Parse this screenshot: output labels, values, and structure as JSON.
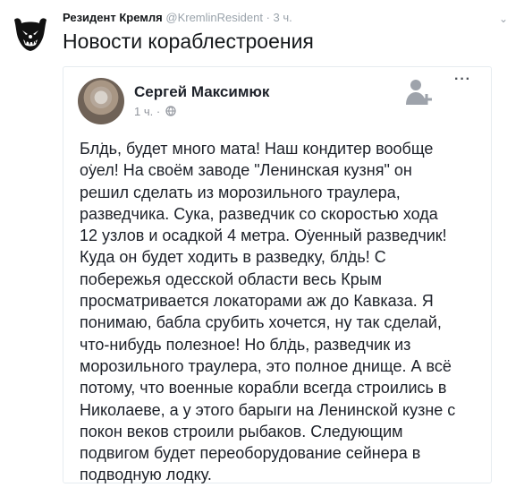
{
  "tweet": {
    "author_name": "Резидент Кремля",
    "handle": "@KremlinResident",
    "separator": "·",
    "time": "3 ч.",
    "text": "Новости кораблестроения"
  },
  "embedded_post": {
    "name": "Сергей Максимюк",
    "meta": "1 ч. ·",
    "lines": [
      "Бл͘дь, будет много мата! Наш кондитер вообще",
      "о͘уел! На своём заводе \"Ленинская кузня\" он",
      "решил сделать из морозильного траулера,",
      "разведчика. Сука, разведчик со скоростью хода",
      "12 узлов и осадкой 4 метра. О͘уенный разведчик!",
      "Куда он будет ходить в разведку, бл͘дь! С",
      "побережья одесской области весь Крым",
      "просматривается локаторами аж до Кавказа. Я",
      "понимаю, бабла срубить хочется, ну так сделай,",
      "что-нибудь полезное! Но бл͘дь, разведчик из",
      "морозильного траулера, это полное днище. А всё",
      "потому, что военные корабли всегда строились в",
      "Николаеве, а у этого барыги на Ленинской кузне с",
      "покон веков строили рыбаков. Следующим",
      "подвигом будет переоборудование сейнера в",
      "подводную лодку."
    ]
  },
  "icons": {
    "avatar": "bear-emblem-icon",
    "chevron": "chevron-down-icon",
    "add_friend": "add-friend-icon",
    "more": "more-options-icon",
    "privacy": "globe-icon"
  },
  "colors": {
    "secondary_text": "#9aa3ab",
    "card_border": "#e6ecf0",
    "facebook_text": "#1d2129"
  }
}
